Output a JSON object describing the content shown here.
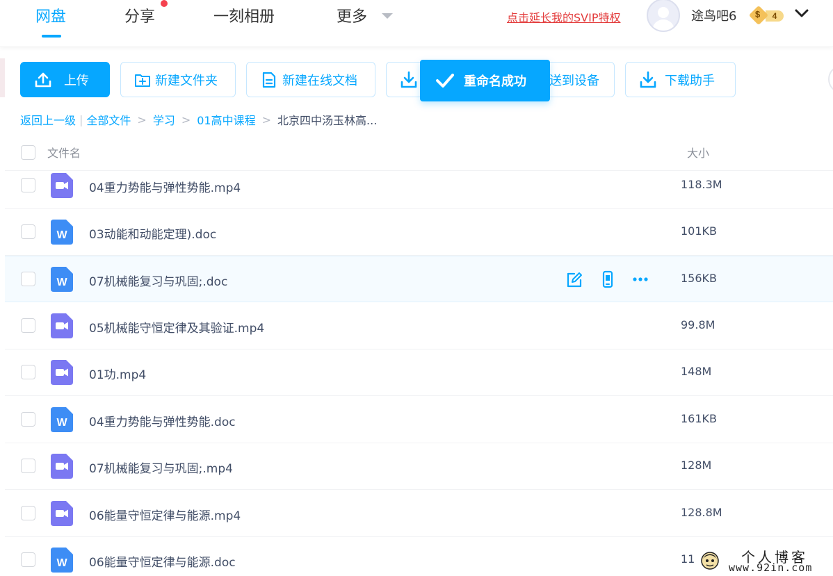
{
  "nav": {
    "tabs": [
      {
        "label": "网盘"
      },
      {
        "label": "分享"
      },
      {
        "label": "一刻相册"
      },
      {
        "label": "更多"
      }
    ],
    "svip_link": "点击延长我的SVIP特权",
    "username": "途鸟吧6",
    "vip_level": "4",
    "vip_symbol": "$"
  },
  "toolbar": {
    "upload": "上传",
    "new_folder": "新建文件夹",
    "new_doc": "新建在线文档",
    "send_device": "送到设备",
    "download_helper": "下载助手"
  },
  "toast": {
    "message": "重命名成功"
  },
  "breadcrumb": {
    "back": "返回上一级",
    "items": [
      "全部文件",
      "学习",
      "01高中课程",
      "北京四中汤玉林高..."
    ]
  },
  "table": {
    "col_name": "文件名",
    "col_size": "大小",
    "rows": [
      {
        "name": "04重力势能与弹性势能.mp4",
        "size": "118.3M",
        "type": "video"
      },
      {
        "name": "03动能和动能定理).doc",
        "size": "101KB",
        "type": "word"
      },
      {
        "name": "07机械能复习与巩固;.doc",
        "size": "156KB",
        "type": "word"
      },
      {
        "name": "05机械能守恒定律及其验证.mp4",
        "size": "99.8M",
        "type": "video"
      },
      {
        "name": "01功.mp4",
        "size": "148M",
        "type": "video"
      },
      {
        "name": "04重力势能与弹性势能.doc",
        "size": "161KB",
        "type": "word"
      },
      {
        "name": "07机械能复习与巩固;.mp4",
        "size": "128M",
        "type": "video"
      },
      {
        "name": "06能量守恒定律与能源.mp4",
        "size": "128.8M",
        "type": "video"
      },
      {
        "name": "06能量守恒定律与能源.doc",
        "size": "11",
        "type": "word"
      }
    ],
    "word_icon_letter": "W"
  },
  "watermark": {
    "title": "个人博客",
    "url": "www.92in.com"
  },
  "colors": {
    "accent": "#06a7ff",
    "svip_red": "#e33c3c",
    "video_icon": "#7b78f2",
    "word_icon": "#3d8df5"
  }
}
